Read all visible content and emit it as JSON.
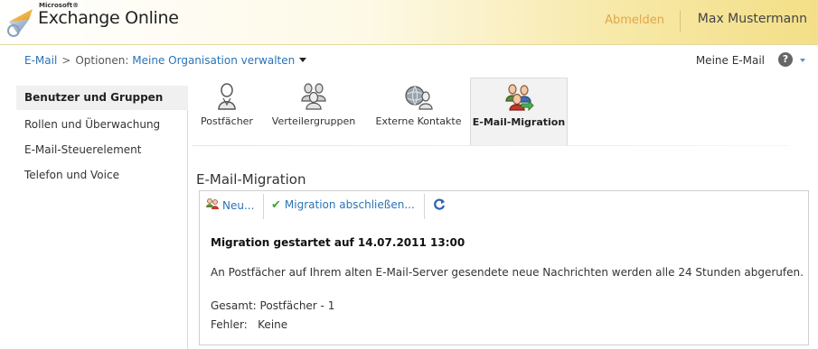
{
  "header": {
    "brand_small": "Microsoft®",
    "product_name": "Exchange Online",
    "signout_label": "Abmelden",
    "user_name": "Max Mustermann"
  },
  "breadcrumb": {
    "mail": "E-Mail",
    "sep": ">",
    "options_label": "Optionen:",
    "org_manage": "Meine Organisation verwalten",
    "my_mail": "Meine E-Mail",
    "help_glyph": "?"
  },
  "sidebar": {
    "items": [
      {
        "label": "Benutzer und Gruppen",
        "active": true
      },
      {
        "label": "Rollen und Überwachung",
        "active": false
      },
      {
        "label": "E-Mail-Steuerelement",
        "active": false
      },
      {
        "label": "Telefon und Voice",
        "active": false
      }
    ]
  },
  "categories": [
    {
      "label": "Postfächer",
      "icon": "user-icon"
    },
    {
      "label": "Verteilergruppen",
      "icon": "group-icon"
    },
    {
      "label": "Externe Kontakte",
      "icon": "external-contact-icon"
    },
    {
      "label": "E-Mail-Migration",
      "icon": "migration-icon",
      "active": true
    }
  ],
  "section": {
    "title": "E-Mail-Migration",
    "toolbar": {
      "new_label": "Neu...",
      "complete_label": "Migration abschließen...",
      "refresh_icon": "refresh-icon"
    },
    "status_title": "Migration gestartet auf 14.07.2011 13:00",
    "description": "An Postfächer auf Ihrem alten E-Mail-Server gesendete neue Nachrichten werden alle 24 Stunden abgerufen.",
    "total_line": "Gesamt: Postfächer - 1",
    "errors_line": "Fehler:   Keine"
  },
  "colors": {
    "link": "#2a73b8",
    "header_gold": "#f3df87",
    "signout": "#e2a64a"
  }
}
